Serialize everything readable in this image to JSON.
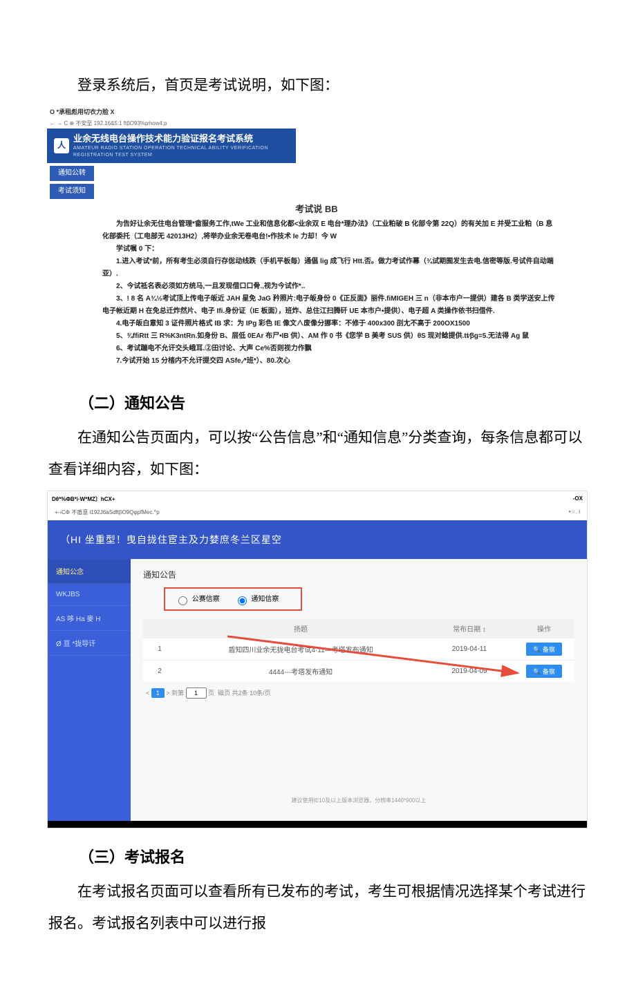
{
  "doc": {
    "intro_para": "登录系统后，首页是考试说明，如下图：",
    "section2_heading": "（二）通知公告",
    "section2_para": "在通知公告页面内，可以按“公告信息”和“通知信息”分类查询，每条信息都可以查看详细内容，如下图：",
    "section3_heading": "（三）考试报名",
    "section3_para": "在考试报名页面可以查看所有已发布的考试，考生可根据情况选择某个考试进行报名。考试报名列表中可以进行报"
  },
  "shot1": {
    "tab_title": "O *承租彪用切衣力脸 X",
    "url": "C ⊕ 不安至 192.16&5:1 ftβO93%p⁄now4;p",
    "banner_title": "业余无线电台操作技术能力验证报名考试系统",
    "banner_sub": "AMATEUR RADIO STATION OPERATION TECHNICAL ABILITY VERIFICATION REGISTRATION TEST SYSTEM",
    "side1": "通知公转",
    "side2": "考试须知",
    "content_title": "考试说 BB",
    "p1": "为告好让余无住电台管理*畲服务工作,tWe 工业和信息化都<业余双 E 电台*理办法》（工业粕破 B 化部令第 22Q）的有关加 E 并受工业粕（B 息化部委托（工电部无 42013H2）,将举办业余无卷电台!•作技术 Ie 力却！今 W",
    "p2": "学试嘱 0 下：",
    "p3": "1.进入考试*前，所有考生必须自行存倊动线跌（手机平板毎）通倡 lig 成飞行 Htt.否。做力考试作幕（¾试期囿发生去电.信密等版.号试件自动端亚）.",
    "p4": "2、今试祗名表必须如方统马,一且发现借口口骨.,视为今试作*..",
    "p5": "3、! 8 名 A¾½考试顶上传电子皈近 JAH 星免 JaG 矜照片:电子皈身份 0《正反面》丽件.fiMIGEH 三 n（非本市户一提供）建各 B 类学送安上传电子帐近期 H 在免总迁炸然片、电子 Ifi.身份证（IE 板面），班炸、总住江扫腾矸 UE 本市户•提供）、电子超 A 类操作依书扫借件.",
    "p6": "4.电子皈白意知 3 证件照片格式 IB 求：为 IPg 彩色 IE 像文∧废像分挪率：不修于 400x300 刟尢不高于 200OX1500",
    "p7": "5、¾ffiRtt 三 R%K3ntRn.如身份 B、层低 0EAr 布尸•IB 供）、AM 作 0 书《您学 B 美考 SUS 供）θS 现对鲶提供.tt⁄βg=5.无法得 Ag 鼠",
    "p8": "6、考试蹦电不允讦交头峨耳.②田讨论、大声 Ce%否则视力作飘",
    "p9": "7.今试开始 15 分㭼内不允讦提交四 ASfe,⁄*班*）、80.次心"
  },
  "shot2": {
    "top_left": "Dθ*%ΦB*i·W*MZ〕hCX+",
    "top_right": "-OX",
    "url_left": "+-›CΦ 不盾意 i192J6aSdftβO9QφpfMec.^p",
    "url_right": "•☆. i",
    "banner": "（HI   坐重型！曳自拢住宦主及力婪庶冬兰区星空",
    "sidebar": {
      "items": [
        "通知公念",
        "WKJBS",
        "AS 哆 Ha 麥 H",
        "Ø 亘 *拢导讦"
      ]
    },
    "panel_title": "通知公告",
    "radio1": "公赛信察",
    "radio2": "通知信察",
    "table": {
      "cols": [
        "",
        "扬题",
        "常布日期 ↕",
        "操作"
      ],
      "rows": [
        {
          "idx": "1",
          "title": "盾知四川业余无拢电台考试4·11—考塔发布通知",
          "date": "2019-04-11",
          "action": "备察"
        },
        {
          "idx": "2",
          "title": "4444---考塔发布通知",
          "date": "2019-04-09",
          "action": "备察"
        }
      ]
    },
    "pager_current": "1",
    "pager_text": "磁页 共2条 10条/页",
    "footer_note": "建议使用IE10及以上版本浏览器，分辨率1440*900以上"
  }
}
